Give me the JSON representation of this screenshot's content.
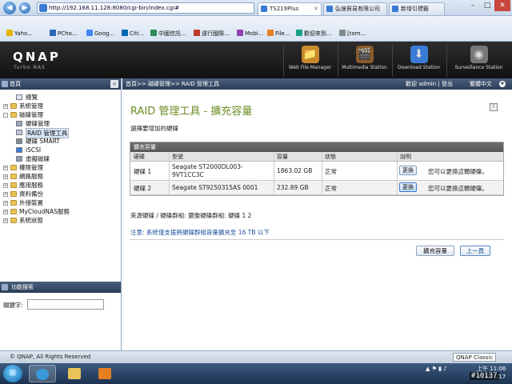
{
  "browser": {
    "url": "http://192.168.11.128:8080/cgi-bin/index.cgi#",
    "tabs": [
      {
        "label": "TS219Plus"
      },
      {
        "label": "弘億貿易有限公司"
      },
      {
        "label": "新增引標籤"
      }
    ],
    "favorites": [
      {
        "label": "Yaho..."
      },
      {
        "label": "PCho..."
      },
      {
        "label": "Goog..."
      },
      {
        "label": "Citi..."
      },
      {
        "label": "中國信託..."
      },
      {
        "label": "遠行國際..."
      },
      {
        "label": "Mobi..."
      },
      {
        "label": "File..."
      },
      {
        "label": "歡迎來到..."
      },
      {
        "label": "[tom..."
      }
    ]
  },
  "header": {
    "logo": "QNAP",
    "subtitle": "Turbo NAS",
    "stations": [
      {
        "label": "Web File Manager",
        "color": "#c98a2e"
      },
      {
        "label": "Multimedia Station",
        "color": "#8a5a2a"
      },
      {
        "label": "Download Station",
        "color": "#3a7bd5"
      },
      {
        "label": "Surveillance Station",
        "color": "#777777"
      }
    ]
  },
  "sidebar": {
    "title": "首頁",
    "items": [
      {
        "label": "總覽",
        "level": 1,
        "toggle": "",
        "icon": "doc"
      },
      {
        "label": "系統管理",
        "level": 0,
        "toggle": "+",
        "icon": "folder"
      },
      {
        "label": "磁碟管理",
        "level": 0,
        "toggle": "-",
        "icon": "folder"
      },
      {
        "label": "硬碟管理",
        "level": 1,
        "toggle": "",
        "icon": "disk"
      },
      {
        "label": "RAID 管理工具",
        "level": 1,
        "toggle": "",
        "icon": "raid",
        "selected": true
      },
      {
        "label": "硬碟 SMART",
        "level": 1,
        "toggle": "",
        "icon": "smart"
      },
      {
        "label": "iSCSI",
        "level": 1,
        "toggle": "",
        "icon": "iscsi"
      },
      {
        "label": "虛擬磁碟",
        "level": 1,
        "toggle": "",
        "icon": "vdisk"
      },
      {
        "label": "權限管理",
        "level": 0,
        "toggle": "+",
        "icon": "folder"
      },
      {
        "label": "網路服務",
        "level": 0,
        "toggle": "+",
        "icon": "folder"
      },
      {
        "label": "應用服務",
        "level": 0,
        "toggle": "+",
        "icon": "folder"
      },
      {
        "label": "資料備份",
        "level": 0,
        "toggle": "+",
        "icon": "folder"
      },
      {
        "label": "外接裝置",
        "level": 0,
        "toggle": "+",
        "icon": "folder"
      },
      {
        "label": "MyCloudNAS服務",
        "level": 0,
        "toggle": "+",
        "icon": "folder"
      },
      {
        "label": "系統狀態",
        "level": 0,
        "toggle": "+",
        "icon": "folder"
      }
    ],
    "search": {
      "title": "功能搜索",
      "label": "關鍵字:",
      "value": ""
    }
  },
  "topbar": {
    "breadcrumb": "首頁>> 磁碟管理>> RAID 管理工具",
    "welcome": "歡迎 admin | 登出",
    "language": "繁體中文"
  },
  "main": {
    "title": "RAID 管理工具 - 擴充容量",
    "instruction": "選擇要增加的硬碟",
    "table": {
      "caption": "擴充容量",
      "headers": [
        "硬碟",
        "型號",
        "容量",
        "狀態",
        "說明"
      ],
      "rows": [
        {
          "disk": "硬碟 1",
          "model_line1": "Seagate ST2000DL003-",
          "model_line2": "9VT1CC3C",
          "capacity": "1863.02 GB",
          "status": "正常",
          "button": "更換",
          "note": "您可以更換這顆硬碟。"
        },
        {
          "disk": "硬碟 2",
          "model_line1": "Seagate ST9250315AS 0001",
          "model_line2": "",
          "capacity": "232.89 GB",
          "status": "正常",
          "button": "更換",
          "note": "您可以更換這顆硬碟。"
        }
      ]
    },
    "source": "來源硬碟 / 硬碟群組: 鏡像硬碟群組: 硬碟 1 2",
    "note_label": "注意:",
    "note_text": "系統僅支援將硬碟群組容量擴充至 16 TB 以下",
    "buttons": {
      "expand": "擴充容量",
      "back": "上一頁"
    }
  },
  "statusbar": {
    "copyright": "© QNAP, All Rights Reserved",
    "theme": "QNAP Classic"
  },
  "taskbar": {
    "time": "上午 11:06",
    "date": "2011/1/17"
  },
  "watermark": "#10137"
}
